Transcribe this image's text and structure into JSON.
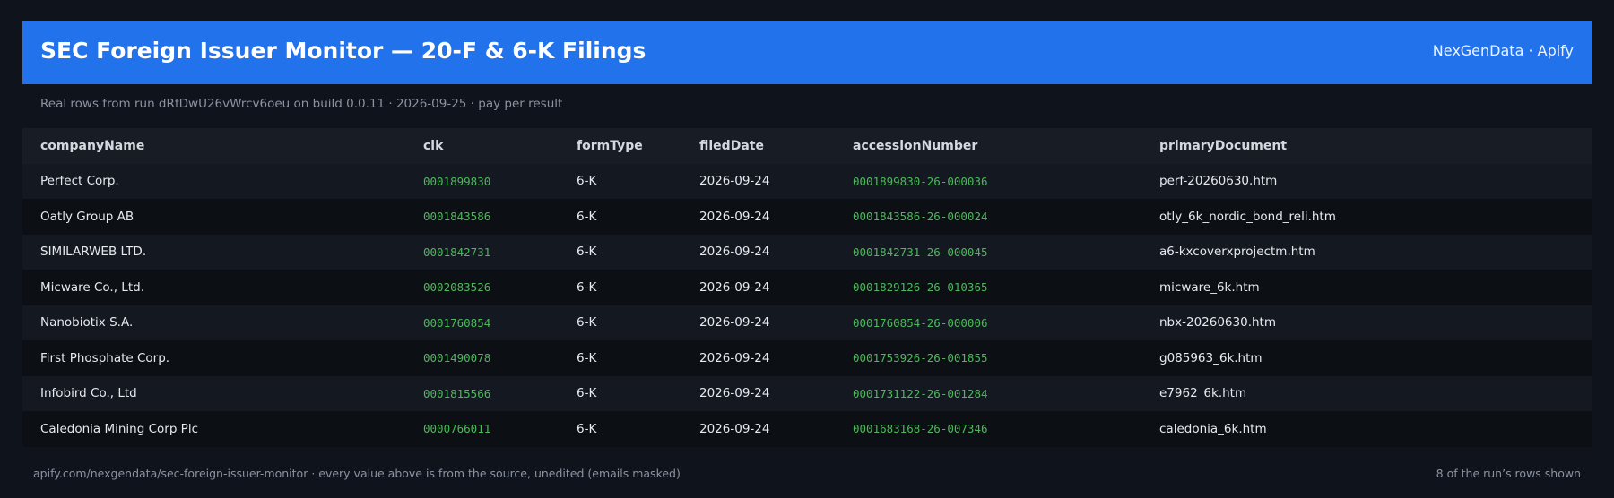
{
  "header": {
    "title": "SEC Foreign Issuer Monitor — 20-F & 6-K Filings",
    "brand": "NexGenData · Apify"
  },
  "subtitle": "Real rows from run dRfDwU26vWrcv6oeu on build 0.0.11 · 2026-09-25 · pay per result",
  "table": {
    "columns": [
      "companyName",
      "cik",
      "formType",
      "filedDate",
      "accessionNumber",
      "primaryDocument"
    ],
    "rows": [
      [
        "Perfect Corp.",
        "0001899830",
        "6-K",
        "2026-09-24",
        "0001899830-26-000036",
        "perf-20260630.htm"
      ],
      [
        "Oatly Group AB",
        "0001843586",
        "6-K",
        "2026-09-24",
        "0001843586-26-000024",
        "otly_6k_nordic_bond_reli.htm"
      ],
      [
        "SIMILARWEB LTD.",
        "0001842731",
        "6-K",
        "2026-09-24",
        "0001842731-26-000045",
        "a6-kxcoverxprojectm.htm"
      ],
      [
        "Micware Co., Ltd.",
        "0002083526",
        "6-K",
        "2026-09-24",
        "0001829126-26-010365",
        "micware_6k.htm"
      ],
      [
        "Nanobiotix S.A.",
        "0001760854",
        "6-K",
        "2026-09-24",
        "0001760854-26-000006",
        "nbx-20260630.htm"
      ],
      [
        "First Phosphate Corp.",
        "0001490078",
        "6-K",
        "2026-09-24",
        "0001753926-26-001855",
        "g085963_6k.htm"
      ],
      [
        "Infobird Co., Ltd",
        "0001815566",
        "6-K",
        "2026-09-24",
        "0001731122-26-001284",
        "e7962_6k.htm"
      ],
      [
        "Caledonia Mining Corp Plc",
        "0000766011",
        "6-K",
        "2026-09-24",
        "0001683168-26-007346",
        "caledonia_6k.htm"
      ]
    ]
  },
  "footer": {
    "left": "apify.com/nexgendata/sec-foreign-issuer-monitor  ·  every value above is from the source, unedited (emails masked)",
    "right": "8 of the run’s rows shown"
  },
  "colors": {
    "header_bg": "#2272ec",
    "page_bg": "#0f131b",
    "id_green": "#4cb85a"
  }
}
